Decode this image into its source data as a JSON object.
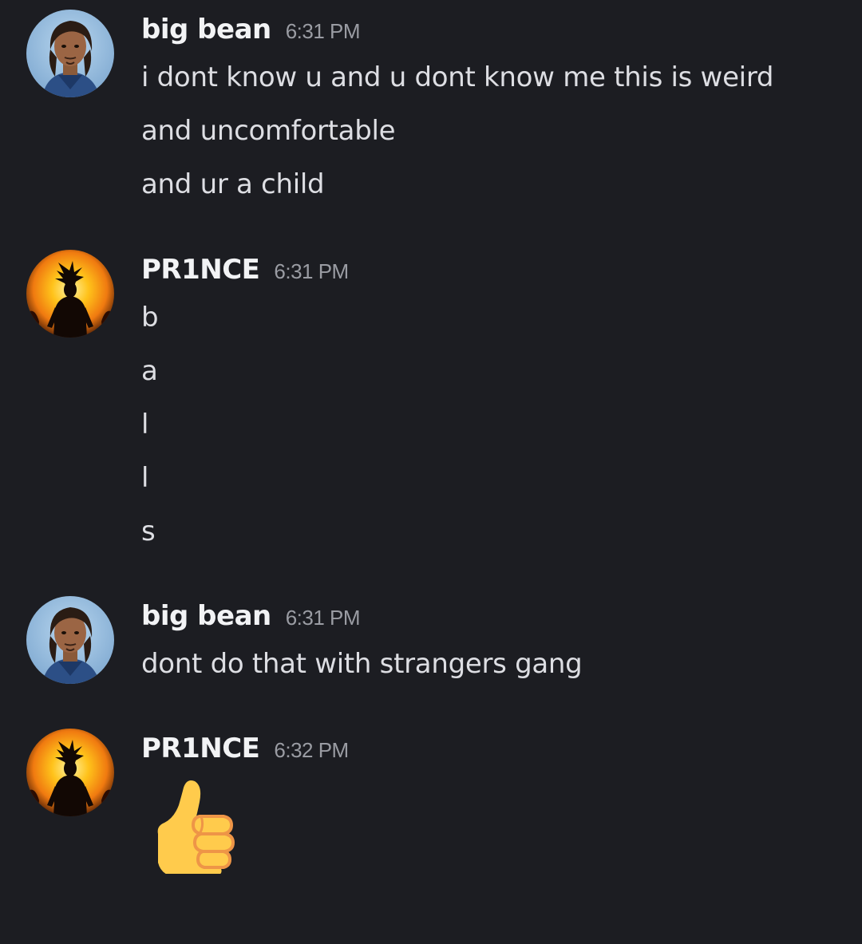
{
  "messages": [
    {
      "username": "big bean",
      "timestamp": "6:31 PM",
      "avatar": "bean-avatar-icon",
      "lines": [
        "i dont know u and u dont know me this is weird",
        "and uncomfortable",
        "and ur a child"
      ]
    },
    {
      "username": "PR1NCE",
      "timestamp": "6:31 PM",
      "avatar": "prince-avatar-icon",
      "lines": [
        "b",
        "a",
        "l",
        "l",
        "s"
      ]
    },
    {
      "username": "big bean",
      "timestamp": "6:31 PM",
      "avatar": "bean-avatar-icon",
      "lines": [
        "dont do that with strangers gang"
      ]
    },
    {
      "username": "PR1NCE",
      "timestamp": "6:32 PM",
      "avatar": "prince-avatar-icon",
      "emoji": "thumbs-up-icon"
    }
  ],
  "colors": {
    "background": "#1c1d22",
    "username": "#f2f3f5",
    "text": "#dddee3",
    "timestamp": "#9a9ca3",
    "thumbs_fill": "#ffcb4c",
    "thumbs_shade": "#ee9547"
  }
}
